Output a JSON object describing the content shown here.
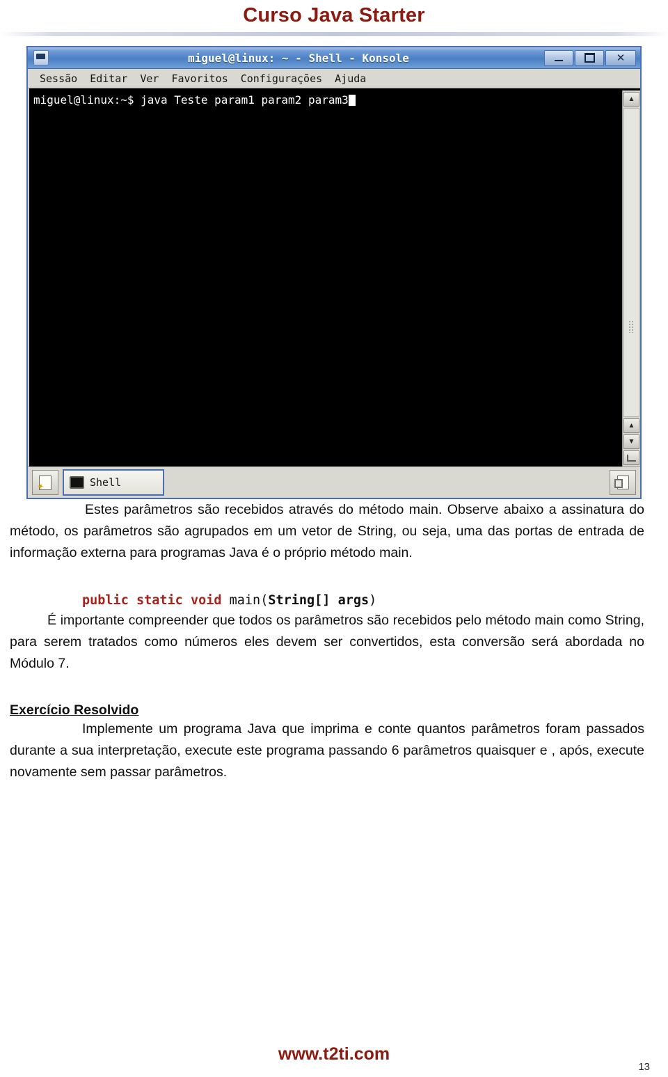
{
  "header": {
    "title": "Curso Java Starter"
  },
  "konsole": {
    "window_title": "miguel@linux: ~ - Shell - Konsole",
    "icon_name": "konsole-window-icon",
    "buttons": {
      "minimize": "minimize",
      "maximize": "maximize",
      "close": "✕"
    },
    "menus": [
      "Sessão",
      "Editar",
      "Ver",
      "Favoritos",
      "Configurações",
      "Ajuda"
    ],
    "terminal": {
      "prompt": "miguel@linux:~$ ",
      "command": "java Teste param1 param2 param3",
      "cursor": "block"
    },
    "scrollbar": {
      "up_arrow": "▲",
      "down_arrow": "▼"
    },
    "tabbar": {
      "new_session_label": "new-session",
      "tab_label": "Shell",
      "right_button_label": "copy-session"
    }
  },
  "content": {
    "paragraph_1": "Estes parâmetros são recebidos através do método main. Observe abaixo a assinatura do método, os parâmetros são agrupados em um vetor de String, ou seja, uma das portas de entrada de informação externa para programas Java é o próprio método main.",
    "code": {
      "kw_public": "public",
      "kw_static": "static",
      "kw_void": "void",
      "main": "main(",
      "args": "String[] args",
      "close_paren": ")"
    },
    "paragraph_2": "É importante compreender que todos os parâmetros são recebidos pelo método main como String, para serem tratados como números eles devem ser convertidos, esta conversão será abordada no Módulo 7.",
    "section_heading": "Exercício Resolvido",
    "paragraph_3": "Implemente um programa Java que imprima e conte quantos parâmetros foram passados durante a sua interpretação, execute este programa passando 6 parâmetros quaisquer e , após, execute novamente sem passar parâmetros."
  },
  "footer": {
    "site": "www.t2ti.com",
    "page_number": "13"
  },
  "colors": {
    "title_red": "#8B1A11",
    "keyword_red": "#A8231C",
    "titlebar_blue": "#4a7fc4"
  }
}
